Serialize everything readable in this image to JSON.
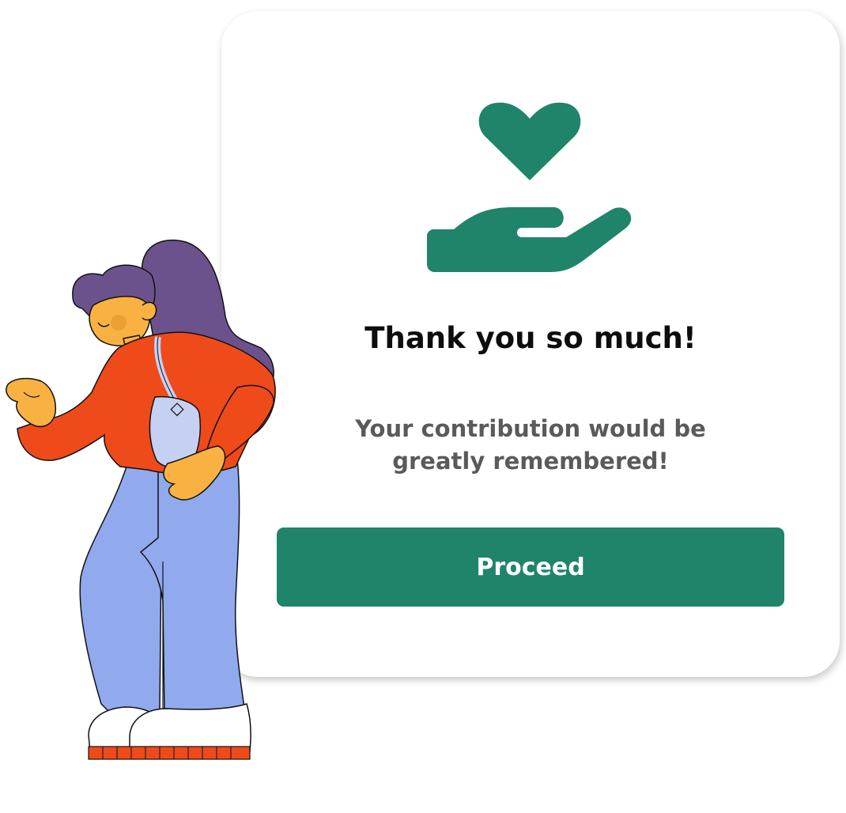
{
  "dialog": {
    "title": "Thank you so much!",
    "message": "Your contribution would be greatly remembered!",
    "proceed_label": "Proceed"
  },
  "icons": {
    "hero": "heart-in-hand-icon"
  },
  "colors": {
    "accent": "#1f846a",
    "title_text": "#0d0d0d",
    "body_text": "#5a5a5a",
    "background": "#ffffff"
  }
}
